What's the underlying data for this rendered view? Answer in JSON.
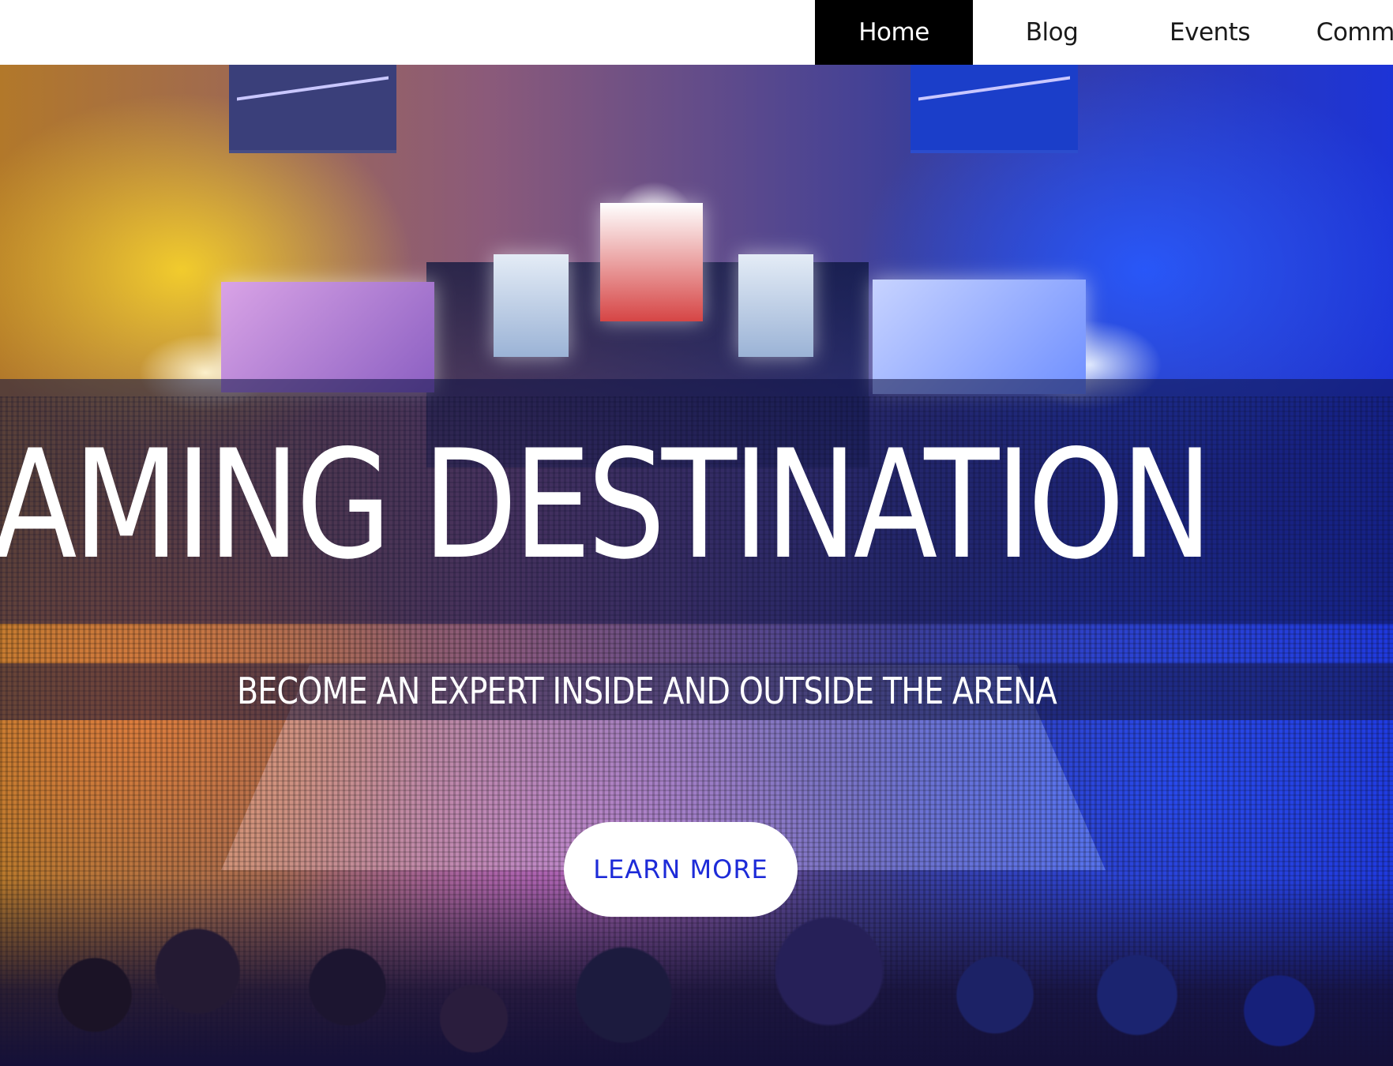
{
  "nav": {
    "items": [
      {
        "label": "Home",
        "active": true
      },
      {
        "label": "Blog",
        "active": false
      },
      {
        "label": "Events",
        "active": false
      },
      {
        "label": "Commur",
        "active": false
      }
    ]
  },
  "hero": {
    "title": "AMING DESTINATION",
    "subtitle": "BECOME AN EXPERT INSIDE AND OUTSIDE THE ARENA",
    "cta_label": "LEARN MORE",
    "background_image": "esports-arena-photo"
  },
  "colors": {
    "nav_active_bg": "#000000",
    "nav_active_text": "#ffffff",
    "cta_text": "#1d2bd8",
    "cta_bg": "#ffffff"
  }
}
